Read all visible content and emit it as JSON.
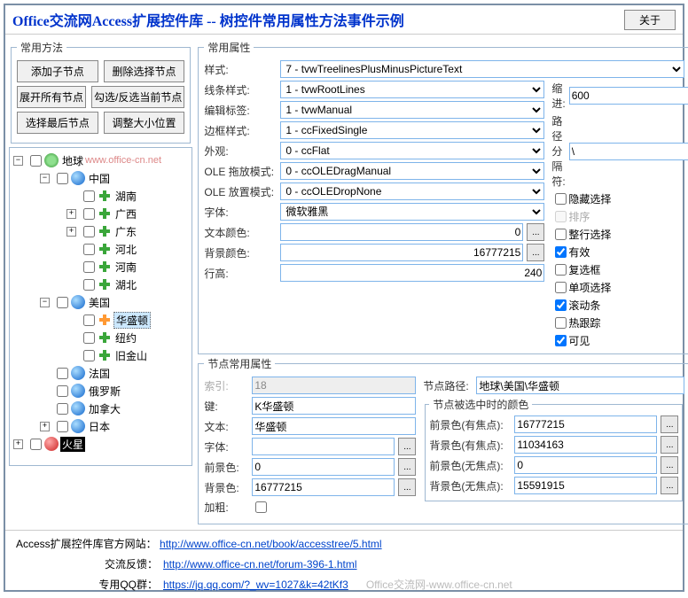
{
  "title": "Office交流网Access扩展控件库 -- 树控件常用属性方法事件示例",
  "about_btn": "关于",
  "methods": {
    "legend": "常用方法",
    "buttons": [
      [
        "添加子节点",
        "删除选择节点"
      ],
      [
        "展开所有节点",
        "勾选/反选当前节点"
      ],
      [
        "选择最后节点",
        "调整大小位置"
      ]
    ]
  },
  "tree": {
    "earth": "地球",
    "earth_watermark": "www.office-cn.net",
    "china": "中国",
    "hunan": "湖南",
    "guangxi": "广西",
    "guangdong": "广东",
    "hebei": "河北",
    "henan": "河南",
    "hubei": "湖北",
    "usa": "美国",
    "washington": "华盛顿",
    "newyork": "纽约",
    "sanfrancisco": "旧金山",
    "france": "法国",
    "russia": "俄罗斯",
    "canada": "加拿大",
    "japan": "日本",
    "mars": "火星"
  },
  "props": {
    "legend": "常用属性",
    "style_label": "样式:",
    "style_value": "7 - tvwTreelinesPlusMinusPictureText",
    "linestyle_label": "线条样式:",
    "linestyle_value": "1 - tvwRootLines",
    "indent_label": "缩进:",
    "indent_value": "600",
    "editlabel_label": "编辑标签:",
    "editlabel_value": "1 - tvwManual",
    "pathsep_label": "路径分隔符:",
    "pathsep_value": "\\",
    "border_label": "边框样式:",
    "border_value": "1 - ccFixedSingle",
    "appearance_label": "外观:",
    "appearance_value": "0 - ccFlat",
    "oledrag_label": "OLE 拖放模式:",
    "oledrag_value": "0 - ccOLEDragManual",
    "oledrop_label": "OLE 放置模式:",
    "oledrop_value": "0 - ccOLEDropNone",
    "font_label": "字体:",
    "font_value": "微软雅黑",
    "textcolor_label": "文本颜色:",
    "textcolor_value": "0",
    "bgcolor_label": "背景颜色:",
    "bgcolor_value": "16777215",
    "rowheight_label": "行高:",
    "rowheight_value": "240",
    "check_hidesel": "隐藏选择",
    "check_sort": "排序",
    "check_fullrow": "整行选择",
    "check_enabled": "有效",
    "check_checkbox": "复选框",
    "check_single": "单项选择",
    "check_scroll": "滚动条",
    "check_hottrack": "热跟踪",
    "check_visible": "可见"
  },
  "node_props": {
    "legend": "节点常用属性",
    "index_label": "索引:",
    "index_value": "18",
    "path_label": "节点路径:",
    "path_value": "地球\\美国\\华盛顿",
    "key_label": "键:",
    "key_value": "K华盛顿",
    "text_label": "文本:",
    "text_value": "华盛顿",
    "font_label": "字体:",
    "font_value": "",
    "forecolor_label": "前景色:",
    "forecolor_value": "0",
    "backcolor_label": "背景色:",
    "backcolor_value": "16777215",
    "bold_label": "加粗:",
    "selected_colors_legend": "节点被选中时的颜色",
    "fg_focus_label": "前景色(有焦点):",
    "fg_focus_value": "16777215",
    "bg_focus_label": "背景色(有焦点):",
    "bg_focus_value": "11034163",
    "fg_nofocus_label": "前景色(无焦点):",
    "fg_nofocus_value": "0",
    "bg_nofocus_label": "背景色(无焦点):",
    "bg_nofocus_value": "15591915"
  },
  "footer": {
    "site_label": "Access扩展控件库官方网站：",
    "site_url": "http://www.office-cn.net/book/accesstree/5.html",
    "feedback_label": "交流反馈：",
    "feedback_url": "http://www.office-cn.net/forum-396-1.html",
    "qq_label": "专用QQ群：",
    "qq_url": "https://jq.qq.com/?_wv=1027&k=42tKf3",
    "watermark": "Office交流网-www.office-cn.net"
  }
}
